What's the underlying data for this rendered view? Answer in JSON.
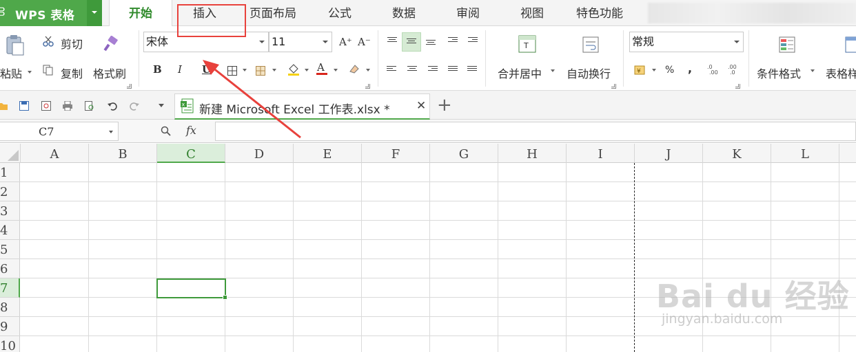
{
  "app": {
    "system_icon": "⫖",
    "name": "WPS 表格"
  },
  "tabs": [
    {
      "label": "开始",
      "active": true
    },
    {
      "label": "插入",
      "active": false
    },
    {
      "label": "页面布局",
      "active": false
    },
    {
      "label": "公式",
      "active": false
    },
    {
      "label": "数据",
      "active": false
    },
    {
      "label": "审阅",
      "active": false
    },
    {
      "label": "视图",
      "active": false
    },
    {
      "label": "特色功能",
      "active": false
    }
  ],
  "ribbon": {
    "paste_label": "粘贴",
    "cut_label": "剪切",
    "copy_label": "复制",
    "format_painter_label": "格式刷",
    "font_name": "宋体",
    "font_size": "11",
    "bold": "B",
    "italic": "I",
    "underline": "U",
    "increase_font": "A⁺",
    "decrease_font": "A⁻",
    "merge_center_label": "合并居中",
    "wrap_text_label": "自动换行",
    "number_format": "常规",
    "percent": "%",
    "comma": ",",
    "conditional_format_label": "条件格式",
    "table_style_label": "表格样"
  },
  "document_tab": {
    "title": "新建 Microsoft Excel 工作表.xlsx *",
    "close": "✕"
  },
  "new_tab": "+",
  "formula_bar": {
    "name_box": "C7",
    "fx_label": "fx",
    "formula": ""
  },
  "grid": {
    "columns": [
      "A",
      "B",
      "C",
      "D",
      "E",
      "F",
      "G",
      "H",
      "I",
      "J",
      "K",
      "L"
    ],
    "rows": [
      "1",
      "2",
      "3",
      "4",
      "5",
      "6",
      "7",
      "8",
      "9",
      "10"
    ],
    "selected_cell": "C7"
  },
  "watermark": {
    "line1": "Bai du 经验",
    "line2": "jingyan.baidu.com"
  },
  "colors": {
    "accent": "#4fa84a",
    "annotation": "#e8413c"
  }
}
